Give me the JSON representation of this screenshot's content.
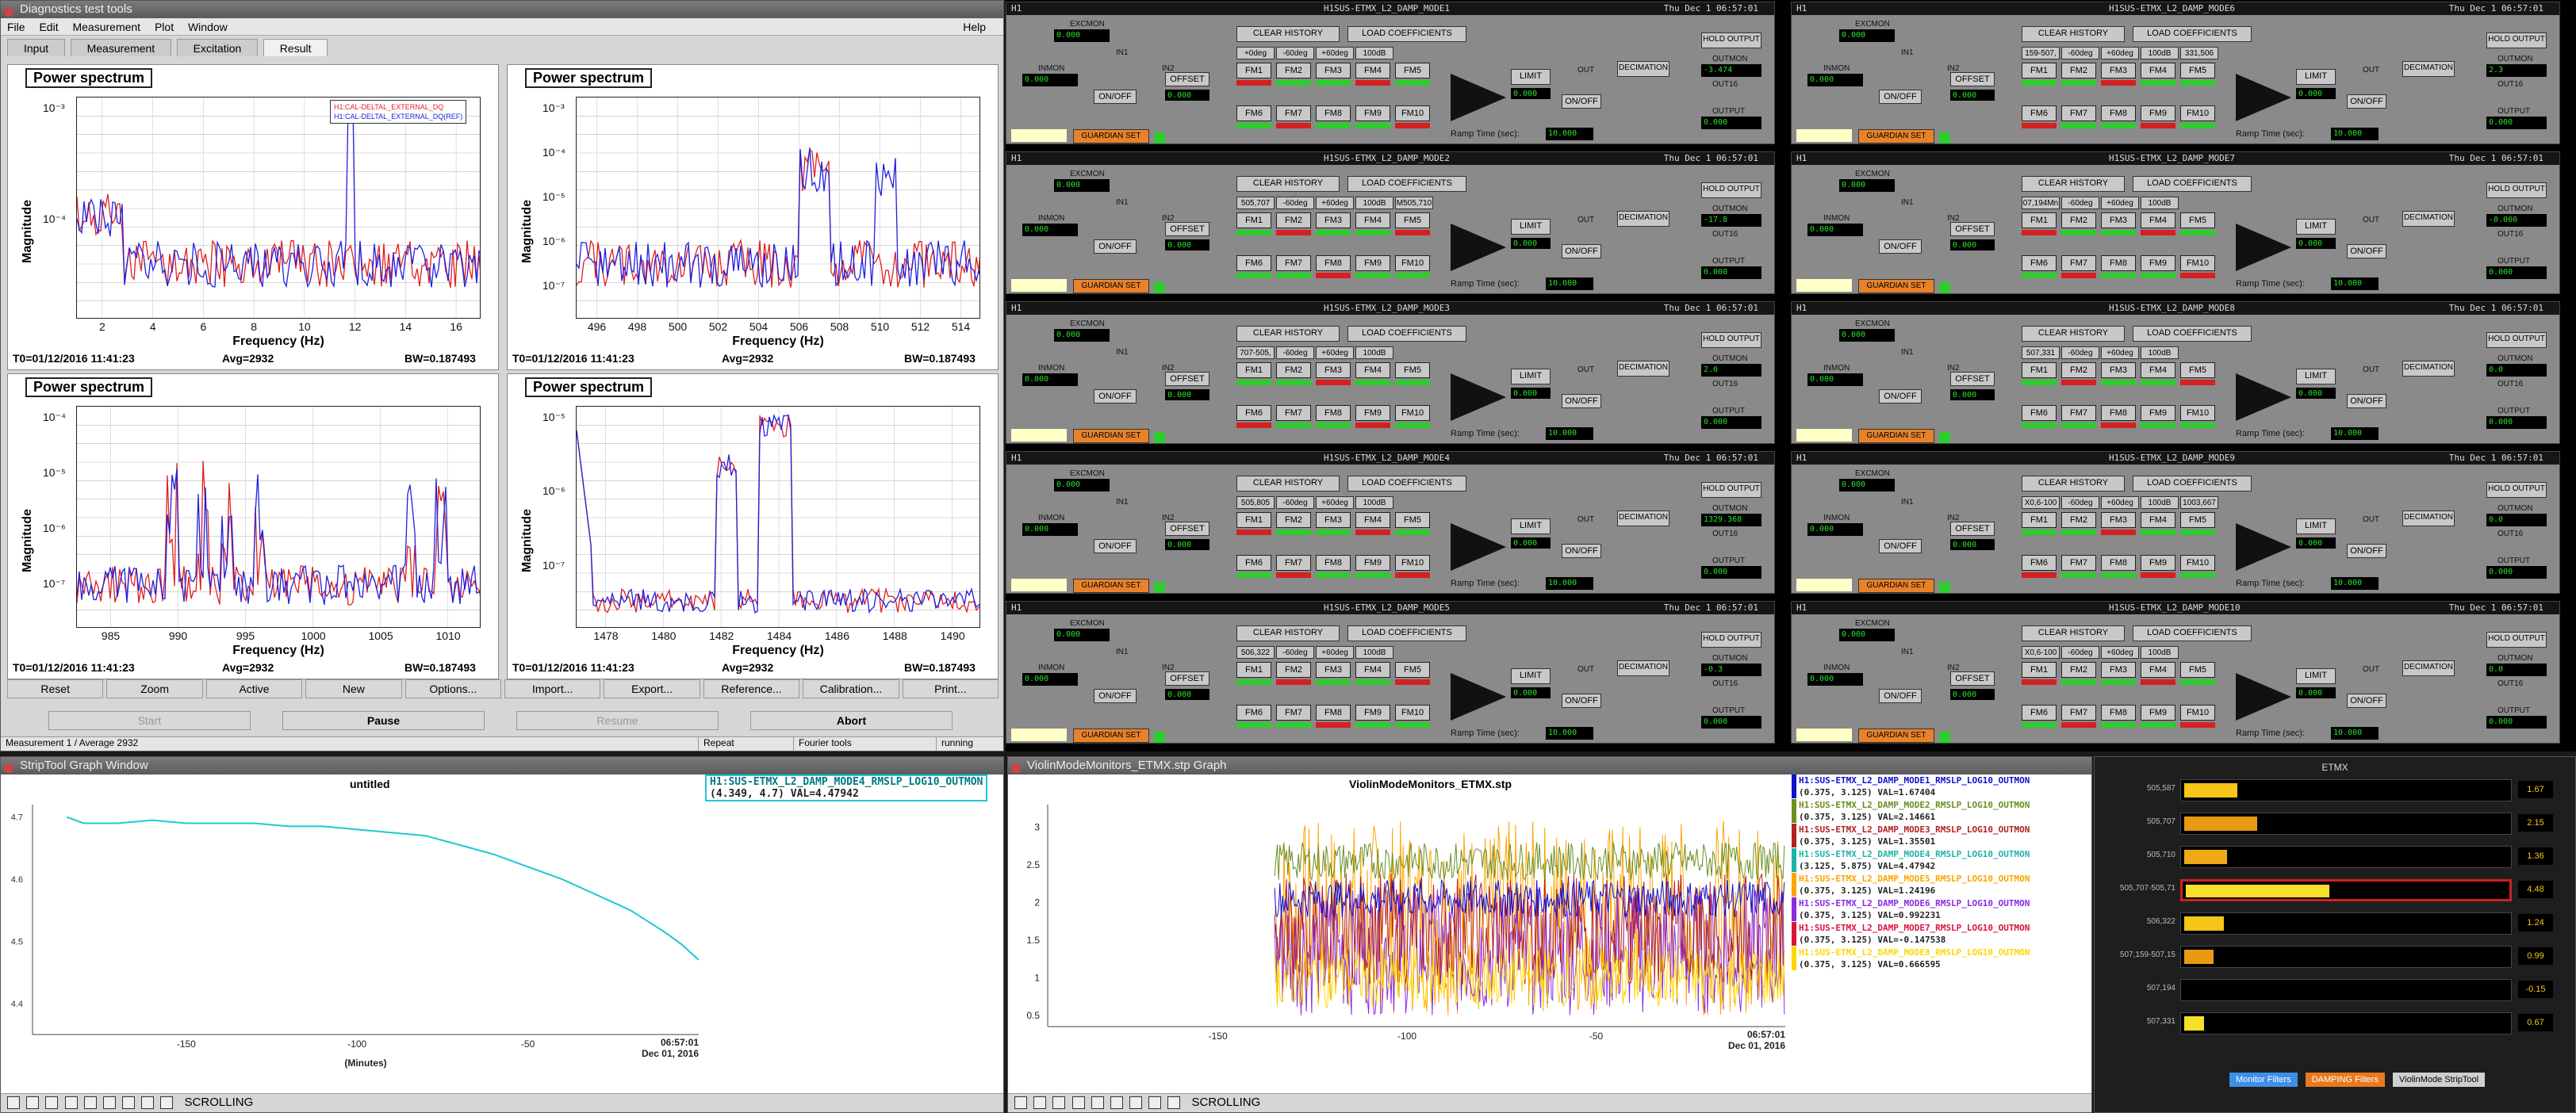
{
  "dtt": {
    "title": "Diagnostics test tools",
    "menu": [
      "File",
      "Edit",
      "Measurement",
      "Plot",
      "Window"
    ],
    "help": "Help",
    "tabs": [
      "Input",
      "Measurement",
      "Excitation",
      "Result"
    ],
    "active_tab": "Result",
    "panels": [
      {
        "title": "Power spectrum",
        "xlabel": "Frequency (Hz)",
        "ylabel": "Magnitude",
        "xticks": [
          "2",
          "4",
          "6",
          "8",
          "10",
          "12",
          "14",
          "16"
        ],
        "yticks": [
          "10⁻³",
          "10⁻⁴"
        ],
        "t0": "T0=01/12/2016 11:41:23",
        "avg": "Avg=2932",
        "bw": "BW=0.187493",
        "legend": [
          "H1:CAL-DELTAL_EXTERNAL_DQ",
          "H1:CAL-DELTAL_EXTERNAL_DQ(REF)"
        ]
      },
      {
        "title": "Power spectrum",
        "xlabel": "Frequency (Hz)",
        "ylabel": "Magnitude",
        "xticks": [
          "496",
          "498",
          "500",
          "502",
          "504",
          "506",
          "508",
          "510",
          "512",
          "514"
        ],
        "yticks": [
          "10⁻³",
          "10⁻⁴",
          "10⁻⁵",
          "10⁻⁶",
          "10⁻⁷"
        ],
        "t0": "T0=01/12/2016 11:41:23",
        "avg": "Avg=2932",
        "bw": "BW=0.187493"
      },
      {
        "title": "Power spectrum",
        "xlabel": "Frequency (Hz)",
        "ylabel": "Magnitude",
        "xticks": [
          "985",
          "990",
          "995",
          "1000",
          "1005",
          "1010"
        ],
        "yticks": [
          "10⁻⁴",
          "10⁻⁵",
          "10⁻⁶",
          "10⁻⁷"
        ],
        "t0": "T0=01/12/2016 11:41:23",
        "avg": "Avg=2932",
        "bw": "BW=0.187493"
      },
      {
        "title": "Power spectrum",
        "xlabel": "Frequency (Hz)",
        "ylabel": "Magnitude",
        "xticks": [
          "1478",
          "1480",
          "1482",
          "1484",
          "1486",
          "1488",
          "1490"
        ],
        "yticks": [
          "10⁻⁵",
          "10⁻⁶",
          "10⁻⁷"
        ],
        "t0": "T0=01/12/2016 11:41:23",
        "avg": "Avg=2932",
        "bw": "BW=0.187493"
      }
    ],
    "buttons_row1": [
      "Reset",
      "Zoom",
      "Active",
      "New",
      "Options...",
      "Import...",
      "Export...",
      "Reference...",
      "Calibration...",
      "Print..."
    ],
    "buttons_row2": [
      "Start",
      "Pause",
      "Resume",
      "Abort"
    ],
    "status": {
      "left": "Measurement 1 / Average 2932",
      "repeat": "Repeat",
      "tools": "Fourier tools",
      "state": "running"
    }
  },
  "medm": {
    "date": "Thu Dec  1 06:57:01",
    "modes": [
      {
        "name": "H1SUS-ETMX_L2_DAMP_MODE1",
        "f": [
          "+0deg",
          "-60deg",
          "+60deg",
          "100dB",
          ""
        ],
        "fv": "505,587",
        "out": "-3.474"
      },
      {
        "name": "H1SUS-ETMX_L2_DAMP_MODE6",
        "f": [
          "159-507,",
          "-60deg",
          "+60deg",
          "100dB",
          "331,506"
        ],
        "fv": "",
        "out": "2.3"
      },
      {
        "name": "H1SUS-ETMX_L2_DAMP_MODE2",
        "f": [
          "505,707",
          "-60deg",
          "+60deg",
          "100dB",
          "M505,710"
        ],
        "fv": "",
        "out": "-17.8"
      },
      {
        "name": "H1SUS-ETMX_L2_DAMP_MODE7",
        "f": [
          "07,194Mn",
          "-60deg",
          "+60deg",
          "100dB",
          ""
        ],
        "fv": "",
        "out": "-0.000"
      },
      {
        "name": "H1SUS-ETMX_L2_DAMP_MODE3",
        "f": [
          "707-505,",
          "-60deg",
          "+60deg",
          "100dB",
          ""
        ],
        "fv": "",
        "out": "2.0"
      },
      {
        "name": "H1SUS-ETMX_L2_DAMP_MODE8",
        "f": [
          "507,331",
          "-60deg",
          "+60deg",
          "100dB",
          ""
        ],
        "fv": "",
        "out": "0.0"
      },
      {
        "name": "H1SUS-ETMX_L2_DAMP_MODE4",
        "f": [
          "505,805",
          "-60deg",
          "+60deg",
          "100dB",
          ""
        ],
        "fv": "",
        "out": "1329.368"
      },
      {
        "name": "H1SUS-ETMX_L2_DAMP_MODE9",
        "f": [
          "X0,6-100",
          "-60deg",
          "+60deg",
          "100dB",
          "1003,667"
        ],
        "fv": "",
        "out": "0.0"
      },
      {
        "name": "H1SUS-ETMX_L2_DAMP_MODE5",
        "f": [
          "506,322",
          "-60deg",
          "+60deg",
          "100dB",
          ""
        ],
        "fv": "",
        "out": "-0.3"
      },
      {
        "name": "H1SUS-ETMX_L2_DAMP_MODE10",
        "f": [
          "X0,6-100",
          "-60deg",
          "+60deg",
          "100dB",
          ""
        ],
        "fv": "",
        "out": "0.0"
      }
    ],
    "labels": {
      "excmon": "EXCMON",
      "inmon": "INMON",
      "in1": "IN1",
      "in2": "IN2",
      "onoff": "ON/OFF",
      "offset": "OFFSET",
      "clear": "CLEAR HISTORY",
      "load": "LOAD COEFFICIENTS",
      "limit": "LIMIT",
      "out": "OUT",
      "decimation": "DECIMATION",
      "hold": "HOLD OUTPUT",
      "outmon": "OUTMON",
      "output": "OUTPUT",
      "out16": "OUT16",
      "ramp": "Ramp Time (sec):",
      "guardian": "GUARDIAN SET",
      "h1": "H1",
      "zero": "0.000",
      "ramp_val": "10.000",
      "fm": [
        "FM1",
        "FM2",
        "FM3",
        "FM4",
        "FM5",
        "FM6",
        "FM7",
        "FM8",
        "FM9",
        "FM10"
      ]
    }
  },
  "strip": {
    "title": "StripTool Graph Window",
    "plot_title": "untitled",
    "legend_name": "H1:SUS-ETMX_L2_DAMP_MODE4_RMSLP_LOG10_OUTMON",
    "legend_val": "(4.349, 4.7) VAL=4.47942",
    "yticks": [
      "4.7",
      "4.6",
      "4.5",
      "4.4"
    ],
    "xticks": [
      "-150",
      "-100",
      "-50"
    ],
    "time": "06:57:01",
    "date": "Dec 01, 2016",
    "xunit": "(Minutes)",
    "toolbar_state": "SCROLLING",
    "color": "#1ec8d2",
    "chart_data": {
      "type": "line",
      "x": [
        -185,
        -180,
        -170,
        -160,
        -150,
        -140,
        -130,
        -120,
        -110,
        -100,
        -90,
        -80,
        -70,
        -60,
        -50,
        -40,
        -30,
        -20,
        -10,
        -5,
        0
      ],
      "y": [
        4.7,
        4.69,
        4.69,
        4.695,
        4.69,
        4.69,
        4.69,
        4.685,
        4.685,
        4.68,
        4.675,
        4.67,
        4.655,
        4.64,
        4.62,
        4.6,
        4.575,
        4.55,
        4.515,
        4.495,
        4.47
      ],
      "ylim": [
        4.35,
        4.72
      ],
      "xlim": [
        -195,
        0
      ]
    }
  },
  "vmon": {
    "title": "ViolinModeMonitors_ETMX.stp Graph",
    "plot_title": "ViolinModeMonitors_ETMX.stp",
    "yticks": [
      "3",
      "2.5",
      "2",
      "1.5",
      "1",
      "0.5"
    ],
    "xticks": [
      "-150",
      "-100",
      "-50"
    ],
    "time": "06:57:01",
    "date": "Dec 01, 2016",
    "toolbar_state": "SCROLLING",
    "legend": [
      {
        "name": "H1:SUS-ETMX_L2_DAMP_MODE1_RMSLP_LOG10_OUTMON",
        "val": "(0.375, 3.125) VAL=1.67404",
        "color": "#1010d0"
      },
      {
        "name": "H1:SUS-ETMX_L2_DAMP_MODE2_RMSLP_LOG10_OUTMON",
        "val": "(0.375, 3.125) VAL=2.14661",
        "color": "#6b8e23"
      },
      {
        "name": "H1:SUS-ETMX_L2_DAMP_MODE3_RMSLP_LOG10_OUTMON",
        "val": "(0.375, 3.125) VAL=1.35501",
        "color": "#b22222"
      },
      {
        "name": "H1:SUS-ETMX_L2_DAMP_MODE4_RMSLP_LOG10_OUTMON",
        "val": "(3.125, 5.875) VAL=4.47942",
        "color": "#20b2aa"
      },
      {
        "name": "H1:SUS-ETMX_L2_DAMP_MODE5_RMSLP_LOG10_OUTMON",
        "val": "(0.375, 3.125) VAL=1.24196",
        "color": "#ffa500"
      },
      {
        "name": "H1:SUS-ETMX_L2_DAMP_MODE6_RMSLP_LOG10_OUTMON",
        "val": "(0.375, 3.125) VAL=0.992231",
        "color": "#8a2be2"
      },
      {
        "name": "H1:SUS-ETMX_L2_DAMP_MODE7_RMSLP_LOG10_OUTMON",
        "val": "(0.375, 3.125) VAL=-0.147538",
        "color": "#dc143c"
      },
      {
        "name": "H1:SUS-ETMX_L2_DAMP_MODE8_RMSLP_LOG10_OUTMON",
        "val": "(0.375, 3.125) VAL=0.666595",
        "color": "#ffd700"
      }
    ]
  },
  "etmx": {
    "title": "ETMX",
    "bars": [
      {
        "label": "505,587",
        "frac": 0.16,
        "val": "1.67",
        "color": "#f5c518"
      },
      {
        "label": "505,707",
        "frac": 0.22,
        "val": "2.15",
        "color": "#e89a10"
      },
      {
        "label": "505,710",
        "frac": 0.13,
        "val": "1.36",
        "color": "#f0a818"
      },
      {
        "label": "505,707-505,71",
        "frac": 0.44,
        "val": "4.48",
        "color": "#f7e02a"
      },
      {
        "label": "506,322",
        "frac": 0.12,
        "val": "1.24",
        "color": "#f5c518"
      },
      {
        "label": "507,159-507,15",
        "frac": 0.09,
        "val": "0.99",
        "color": "#e89a10"
      },
      {
        "label": "507,194",
        "frac": 0.0,
        "val": "-0.15",
        "color": "#f5c518"
      },
      {
        "label": "507,331",
        "frac": 0.06,
        "val": "0.67",
        "color": "#f7e02a"
      }
    ],
    "buttons": [
      "Monitor Filters",
      "DAMPING Filters",
      "ViolinMode StripTool"
    ]
  }
}
